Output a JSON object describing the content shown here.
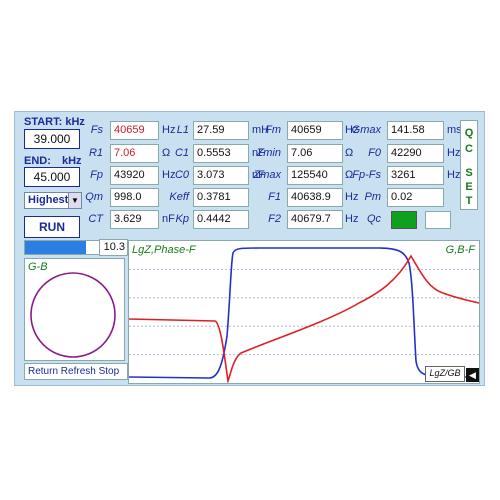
{
  "sweep": {
    "start_label": "START: kHz",
    "start_value": "39.000",
    "end_label": "END:",
    "end_unit": "kHz",
    "end_value": "45.000",
    "level_select": "Highest",
    "run_label": "RUN"
  },
  "params": [
    {
      "label": "Fs",
      "value": "40659",
      "unit": "Hz",
      "red": true
    },
    {
      "label": "R1",
      "value": "7.06",
      "unit": "Ω",
      "red": true
    },
    {
      "label": "Fp",
      "value": "43920",
      "unit": "Hz",
      "red": false
    },
    {
      "label": "Qm",
      "value": "998.0",
      "unit": "",
      "red": false
    },
    {
      "label": "CT",
      "value": "3.629",
      "unit": "nF",
      "red": false
    },
    {
      "label": "L1",
      "value": "27.59",
      "unit": "mH",
      "red": false
    },
    {
      "label": "C1",
      "value": "0.5553",
      "unit": "nF",
      "red": false
    },
    {
      "label": "C0",
      "value": "3.073",
      "unit": "nF",
      "red": false
    },
    {
      "label": "Keff",
      "value": "0.3781",
      "unit": "",
      "red": false
    },
    {
      "label": "Kp",
      "value": "0.4442",
      "unit": "",
      "red": false
    },
    {
      "label": "Fm",
      "value": "40659",
      "unit": "Hz",
      "red": false
    },
    {
      "label": "Zmin",
      "value": "7.06",
      "unit": "Ω",
      "red": false
    },
    {
      "label": "Zmax",
      "value": "125540",
      "unit": "Ω",
      "red": false
    },
    {
      "label": "F1",
      "value": "40638.9",
      "unit": "Hz",
      "red": false
    },
    {
      "label": "F2",
      "value": "40679.7",
      "unit": "Hz",
      "red": false
    },
    {
      "label": "Gmax",
      "value": "141.58",
      "unit": "ms",
      "red": false
    },
    {
      "label": "F0",
      "value": "42290",
      "unit": "Hz",
      "red": false
    },
    {
      "label": "Fp-Fs",
      "value": "3261",
      "unit": "Hz",
      "red": false
    },
    {
      "label": "Pm",
      "value": "0.02",
      "unit": "",
      "red": false
    },
    {
      "label": "Qc",
      "value": "",
      "unit": "",
      "red": false
    }
  ],
  "qc_set": [
    "Q",
    "C",
    "S",
    "E",
    "T"
  ],
  "qc_indicator_color": "#10a020",
  "gb_panel": {
    "level_value": "10.3",
    "level_fill": 0.82,
    "title": "G-B",
    "links": [
      "Return",
      "Refresh",
      "Stop"
    ]
  },
  "plot": {
    "left_title": "LgZ,Phase-F",
    "right_title": "G,B-F",
    "toggle_label": "LgZ/GB"
  },
  "colors": {
    "label_blue": "#1a2a9a",
    "value_red": "#c0202a",
    "curve_blue": "#2230d0",
    "curve_red": "#e02020",
    "circle": "#8a1a8a",
    "qc_green": "#1a7a1a"
  }
}
